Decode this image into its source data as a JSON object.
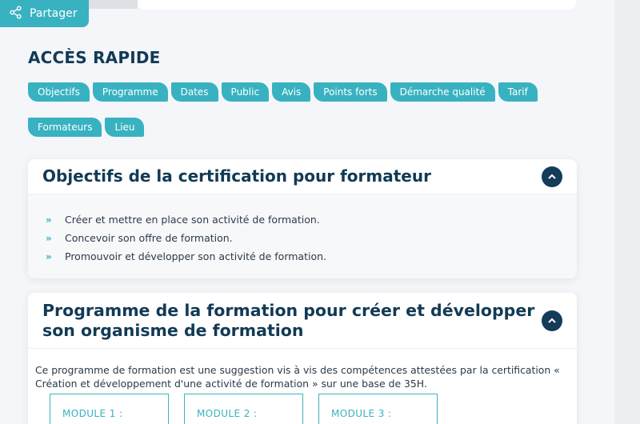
{
  "share": {
    "label": "Partager",
    "icon": "share-icon"
  },
  "quick_access": {
    "title": "ACCÈS RAPIDE",
    "chips": [
      "Objectifs",
      "Programme",
      "Dates",
      "Public",
      "Avis",
      "Points forts",
      "Démarche qualité",
      "Tarif",
      "Formateurs",
      "Lieu"
    ]
  },
  "objectives": {
    "title": "Objectifs de la certification pour formateur",
    "toggle_icon": "chevron-up-icon",
    "items": [
      "Créer et mettre en place son activité de formation.",
      "Concevoir son offre de formation.",
      "Promouvoir et développer son activité de formation."
    ]
  },
  "program": {
    "title": "Programme de la formation pour créer et développer son organisme de formation",
    "toggle_icon": "chevron-up-icon",
    "intro": "Ce programme de formation est une suggestion vis à vis des compétences attestées par la certification « Création et développement d'une activité de formation » sur une base de 35H.",
    "modules": [
      "MODULE 1 :",
      "MODULE 2 :",
      "MODULE 3 :"
    ]
  },
  "colors": {
    "accent": "#38b2c0",
    "dark": "#123a55"
  }
}
